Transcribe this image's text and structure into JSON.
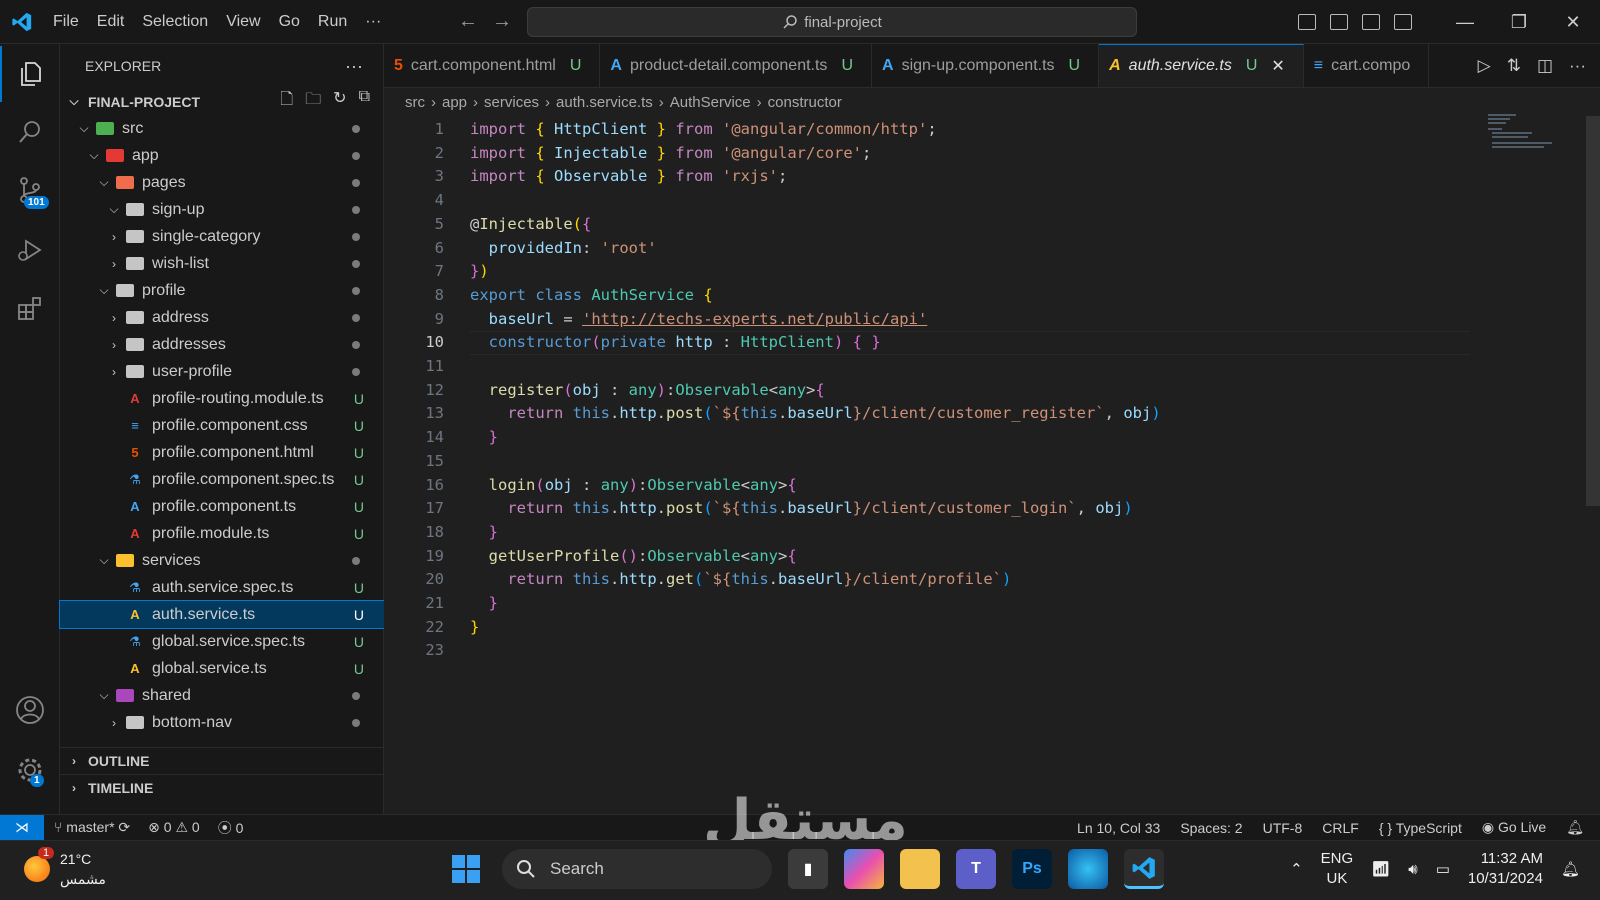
{
  "titlebar": {
    "menu": [
      "File",
      "Edit",
      "Selection",
      "View",
      "Go",
      "Run",
      "···"
    ],
    "command_center": "final-project"
  },
  "activity": {
    "source_control_badge": "101",
    "settings_badge": "1"
  },
  "explorer": {
    "title": "EXPLORER",
    "root": "FINAL-PROJECT",
    "rows": [
      {
        "label": "src",
        "depth": 1,
        "chev": "v",
        "type": "folder-src",
        "status": "dot"
      },
      {
        "label": "app",
        "depth": 2,
        "chev": "v",
        "type": "folder-app",
        "status": "dot"
      },
      {
        "label": "pages",
        "depth": 3,
        "chev": "v",
        "type": "folder-pages",
        "status": "dot"
      },
      {
        "label": "sign-up",
        "depth": 4,
        "chev": "v",
        "type": "folder",
        "status": "dot"
      },
      {
        "label": "single-category",
        "depth": 4,
        "chev": ">",
        "type": "folder",
        "status": "dot"
      },
      {
        "label": "wish-list",
        "depth": 4,
        "chev": ">",
        "type": "folder",
        "status": "dot"
      },
      {
        "label": "profile",
        "depth": 3,
        "chev": "v",
        "type": "folder",
        "status": "dot"
      },
      {
        "label": "address",
        "depth": 4,
        "chev": ">",
        "type": "folder",
        "status": "dot"
      },
      {
        "label": "addresses",
        "depth": 4,
        "chev": ">",
        "type": "folder",
        "status": "dot"
      },
      {
        "label": "user-profile",
        "depth": 4,
        "chev": ">",
        "type": "folder",
        "status": "dot"
      },
      {
        "label": "profile-routing.module.ts",
        "depth": 4,
        "chev": "",
        "type": "angular-red",
        "status": "U"
      },
      {
        "label": "profile.component.css",
        "depth": 4,
        "chev": "",
        "type": "css",
        "status": "U"
      },
      {
        "label": "profile.component.html",
        "depth": 4,
        "chev": "",
        "type": "html",
        "status": "U"
      },
      {
        "label": "profile.component.spec.ts",
        "depth": 4,
        "chev": "",
        "type": "spec",
        "status": "U"
      },
      {
        "label": "profile.component.ts",
        "depth": 4,
        "chev": "",
        "type": "angular-blue",
        "status": "U"
      },
      {
        "label": "profile.module.ts",
        "depth": 4,
        "chev": "",
        "type": "angular-red",
        "status": "U"
      },
      {
        "label": "services",
        "depth": 3,
        "chev": "v",
        "type": "folder-services",
        "status": "dot"
      },
      {
        "label": "auth.service.spec.ts",
        "depth": 4,
        "chev": "",
        "type": "spec",
        "status": "U"
      },
      {
        "label": "auth.service.ts",
        "depth": 4,
        "chev": "",
        "type": "angular-yellow",
        "status": "U",
        "selected": true
      },
      {
        "label": "global.service.spec.ts",
        "depth": 4,
        "chev": "",
        "type": "spec",
        "status": "U"
      },
      {
        "label": "global.service.ts",
        "depth": 4,
        "chev": "",
        "type": "angular-yellow",
        "status": "U"
      },
      {
        "label": "shared",
        "depth": 3,
        "chev": "v",
        "type": "folder-shared",
        "status": "dot"
      },
      {
        "label": "bottom-nav",
        "depth": 4,
        "chev": ">",
        "type": "folder",
        "status": "dot"
      }
    ],
    "outline": "OUTLINE",
    "timeline": "TIMELINE"
  },
  "tabs": [
    {
      "label": "cart.component.html",
      "status": "U",
      "icon": "html"
    },
    {
      "label": "product-detail.component.ts",
      "status": "U",
      "icon": "angular-blue"
    },
    {
      "label": "sign-up.component.ts",
      "status": "U",
      "icon": "angular-blue"
    },
    {
      "label": "auth.service.ts",
      "status": "U",
      "icon": "angular-yellow",
      "active": true
    },
    {
      "label": "cart.compo",
      "status": "",
      "icon": "css"
    }
  ],
  "breadcrumbs": [
    "src",
    "app",
    "services",
    "auth.service.ts",
    "AuthService",
    "constructor"
  ],
  "code": {
    "current_line": 10,
    "lines": [
      [
        [
          "kc",
          "import "
        ],
        [
          "br1",
          "{ "
        ],
        [
          "var",
          "HttpClient"
        ],
        [
          "br1",
          " }"
        ],
        [
          "kc",
          " from "
        ],
        [
          "str",
          "'@angular/common/http'"
        ],
        [
          "",
          "; "
        ]
      ],
      [
        [
          "kc",
          "import "
        ],
        [
          "br1",
          "{ "
        ],
        [
          "var",
          "Injectable"
        ],
        [
          "br1",
          " }"
        ],
        [
          "kc",
          " from "
        ],
        [
          "str",
          "'@angular/core'"
        ],
        [
          "",
          ";"
        ]
      ],
      [
        [
          "kc",
          "import "
        ],
        [
          "br1",
          "{ "
        ],
        [
          "var",
          "Observable"
        ],
        [
          "br1",
          " }"
        ],
        [
          "kc",
          " from "
        ],
        [
          "str",
          "'rxjs'"
        ],
        [
          "",
          ";"
        ]
      ],
      [],
      [
        [
          "",
          "@"
        ],
        [
          "dec",
          "Injectable"
        ],
        [
          "br1",
          "("
        ],
        [
          "br2",
          "{"
        ]
      ],
      [
        [
          "",
          "  "
        ],
        [
          "var",
          "providedIn"
        ],
        [
          "",
          ": "
        ],
        [
          "str",
          "'root'"
        ]
      ],
      [
        [
          "br2",
          "}"
        ],
        [
          "br1",
          ")"
        ]
      ],
      [
        [
          "kw",
          "export "
        ],
        [
          "kw",
          "class "
        ],
        [
          "cls",
          "AuthService "
        ],
        [
          "br1",
          "{"
        ]
      ],
      [
        [
          "",
          "  "
        ],
        [
          "var",
          "baseUrl"
        ],
        [
          "",
          " = "
        ],
        [
          "str",
          "'http://techs-experts.net/public/api'"
        ]
      ],
      [
        [
          "",
          "  "
        ],
        [
          "kw",
          "constructor"
        ],
        [
          "br2",
          "("
        ],
        [
          "kw",
          "private "
        ],
        [
          "var",
          "http"
        ],
        [
          "",
          " : "
        ],
        [
          "cls",
          "HttpClient"
        ],
        [
          "br2",
          ")"
        ],
        [
          "",
          " "
        ],
        [
          "br2",
          "{ }"
        ]
      ],
      [],
      [
        [
          "",
          "  "
        ],
        [
          "fn",
          "register"
        ],
        [
          "br2",
          "("
        ],
        [
          "var",
          "obj"
        ],
        [
          "",
          " : "
        ],
        [
          "cls",
          "any"
        ],
        [
          "br2",
          ")"
        ],
        [
          "",
          ":"
        ],
        [
          "cls",
          "Observable"
        ],
        [
          "",
          "<"
        ],
        [
          "cls",
          "any"
        ],
        [
          "",
          ">"
        ],
        [
          "br2",
          "{"
        ]
      ],
      [
        [
          "",
          "    "
        ],
        [
          "kc",
          "return "
        ],
        [
          "kw",
          "this"
        ],
        [
          "",
          "."
        ],
        [
          "var",
          "http"
        ],
        [
          "",
          "."
        ],
        [
          "fn",
          "post"
        ],
        [
          "br3",
          "("
        ],
        [
          "str",
          "`${"
        ],
        [
          "kw",
          "this"
        ],
        [
          "",
          "."
        ],
        [
          "var",
          "baseUrl"
        ],
        [
          "str",
          "}/client/customer_register`"
        ],
        [
          "",
          ", "
        ],
        [
          "var",
          "obj"
        ],
        [
          "br3",
          ")"
        ]
      ],
      [
        [
          "",
          "  "
        ],
        [
          "br2",
          "}"
        ]
      ],
      [],
      [
        [
          "",
          "  "
        ],
        [
          "fn",
          "login"
        ],
        [
          "br2",
          "("
        ],
        [
          "var",
          "obj"
        ],
        [
          "",
          " : "
        ],
        [
          "cls",
          "any"
        ],
        [
          "br2",
          ")"
        ],
        [
          "",
          ":"
        ],
        [
          "cls",
          "Observable"
        ],
        [
          "",
          "<"
        ],
        [
          "cls",
          "any"
        ],
        [
          "",
          ">"
        ],
        [
          "br2",
          "{"
        ]
      ],
      [
        [
          "",
          "    "
        ],
        [
          "kc",
          "return "
        ],
        [
          "kw",
          "this"
        ],
        [
          "",
          "."
        ],
        [
          "var",
          "http"
        ],
        [
          "",
          "."
        ],
        [
          "fn",
          "post"
        ],
        [
          "br3",
          "("
        ],
        [
          "str",
          "`${"
        ],
        [
          "kw",
          "this"
        ],
        [
          "",
          "."
        ],
        [
          "var",
          "baseUrl"
        ],
        [
          "str",
          "}/client/customer_login`"
        ],
        [
          "",
          ", "
        ],
        [
          "var",
          "obj"
        ],
        [
          "br3",
          ")"
        ]
      ],
      [
        [
          "",
          "  "
        ],
        [
          "br2",
          "}"
        ]
      ],
      [
        [
          "",
          "  "
        ],
        [
          "fn",
          "getUserProfile"
        ],
        [
          "br2",
          "()"
        ],
        [
          "",
          ":"
        ],
        [
          "cls",
          "Observable"
        ],
        [
          "",
          "<"
        ],
        [
          "cls",
          "any"
        ],
        [
          "",
          ">"
        ],
        [
          "br2",
          "{"
        ]
      ],
      [
        [
          "",
          "    "
        ],
        [
          "kc",
          "return "
        ],
        [
          "kw",
          "this"
        ],
        [
          "",
          "."
        ],
        [
          "var",
          "http"
        ],
        [
          "",
          "."
        ],
        [
          "fn",
          "get"
        ],
        [
          "br3",
          "("
        ],
        [
          "str",
          "`${"
        ],
        [
          "kw",
          "this"
        ],
        [
          "",
          "."
        ],
        [
          "var",
          "baseUrl"
        ],
        [
          "str",
          "}/client/profile`"
        ],
        [
          "br3",
          ")"
        ]
      ],
      [
        [
          "",
          "  "
        ],
        [
          "br2",
          "}"
        ]
      ],
      [
        [
          "br1",
          "}"
        ]
      ],
      []
    ]
  },
  "statusbar": {
    "branch": "master*",
    "errors": "0",
    "warnings": "0",
    "ports": "0",
    "position": "Ln 10, Col 33",
    "spaces": "Spaces: 2",
    "encoding": "UTF-8",
    "eol": "CRLF",
    "language": "TypeScript",
    "golive": "Go Live"
  },
  "taskbar": {
    "weather_temp": "21°C",
    "weather_desc": "مشمس",
    "weather_badge": "1",
    "search": "Search",
    "lang1": "ENG",
    "lang2": "UK",
    "time": "11:32 AM",
    "date": "10/31/2024"
  },
  "watermark": "مستقل"
}
